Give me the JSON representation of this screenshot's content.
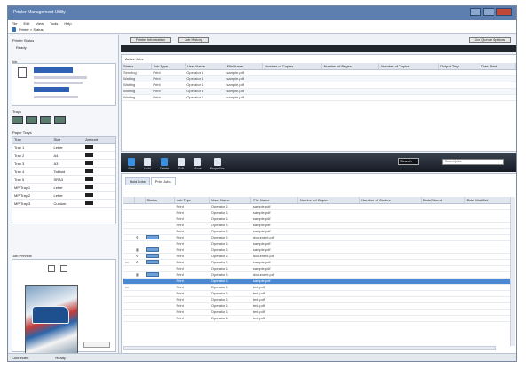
{
  "window": {
    "title": "Printer Management Utility"
  },
  "menu": [
    "File",
    "Edit",
    "View",
    "Tools",
    "Help"
  ],
  "address": {
    "path": "Printer > Status"
  },
  "left": {
    "status_label": "Printer Status",
    "status_value": "Ready",
    "ink_label": "Ink",
    "tray_label": "Trays",
    "paper_label": "Paper Trays",
    "paper_cols": [
      "Tray",
      "Size",
      "Amount"
    ],
    "paper_rows": [
      [
        "Tray 1",
        "Letter"
      ],
      [
        "Tray 2",
        "A4"
      ],
      [
        "Tray 3",
        "A3"
      ],
      [
        "Tray 4",
        "Tabloid"
      ],
      [
        "Tray 5",
        "SRA3"
      ],
      [
        "MP Tray 1",
        "Letter"
      ],
      [
        "MP Tray 2",
        "Letter"
      ],
      [
        "MP Tray 3",
        "Custom"
      ]
    ],
    "preview_label": "Job Preview"
  },
  "top": {
    "left_btn": "Printer Information",
    "mid_btn": "Job History",
    "right_btn": "Job Queue Options"
  },
  "jobs": {
    "label": "Active Jobs",
    "cols": [
      "Status",
      "Job Type",
      "User Name",
      "File Name",
      "Number of Copies",
      "Number of Pages",
      "Number of Copies",
      "Output Tray",
      "Date Sent"
    ],
    "rows": [
      [
        "Sending",
        "Print",
        "Operator 1",
        "sample.pdf"
      ],
      [
        "Waiting",
        "Print",
        "Operator 1",
        "sample.pdf"
      ],
      [
        "Waiting",
        "Print",
        "Operator 1",
        "sample.pdf"
      ],
      [
        "Waiting",
        "Print",
        "Operator 1",
        "sample.pdf"
      ],
      [
        "Waiting",
        "Print",
        "Operator 1",
        "sample.pdf"
      ]
    ]
  },
  "toolbar": {
    "tools": [
      "Print",
      "Hold",
      "Delete",
      "Edit",
      "Move",
      "Properties"
    ],
    "search_small": "Search",
    "search_placeholder": "Search jobs"
  },
  "main": {
    "tabs": [
      "Hold Jobs",
      "Print Jobs"
    ],
    "cols": [
      "",
      "",
      "Status",
      "Job Type",
      "User Name",
      "File Name",
      "Number of Copies",
      "Number of Copies",
      "Date Stored",
      "Date Modified"
    ],
    "rows": [
      [
        "Print",
        "Operator 1",
        "sample.pdf"
      ],
      [
        "Print",
        "Operator 1",
        "sample.pdf"
      ],
      [
        "Print",
        "Operator 1",
        "sample.pdf"
      ],
      [
        "Print",
        "Operator 1",
        "sample.pdf"
      ],
      [
        "Print",
        "Operator 1",
        "sample.pdf"
      ],
      [
        "Print",
        "Operator 1",
        "document.pdf"
      ],
      [
        "Print",
        "Operator 1",
        "sample.pdf"
      ],
      [
        "Print",
        "Operator 1",
        "sample.pdf"
      ],
      [
        "Print",
        "Operator 1",
        "document.pdf"
      ],
      [
        "Print",
        "Operator 1",
        "sample.pdf"
      ],
      [
        "Print",
        "Operator 1",
        "sample.pdf"
      ],
      [
        "Print",
        "Operator 1",
        "document.pdf"
      ],
      [
        "Print",
        "Operator 1",
        "sample.pdf"
      ],
      [
        "Print",
        "Operator 1",
        "test.pdf"
      ],
      [
        "Print",
        "Operator 1",
        "test.pdf"
      ],
      [
        "Print",
        "Operator 1",
        "test.pdf"
      ],
      [
        "Print",
        "Operator 1",
        "test.pdf"
      ],
      [
        "Print",
        "Operator 1",
        "test.pdf"
      ],
      [
        "Print",
        "Operator 1",
        "test.pdf"
      ]
    ]
  },
  "statusbar": {
    "left": "Connected",
    "right": "Ready"
  }
}
